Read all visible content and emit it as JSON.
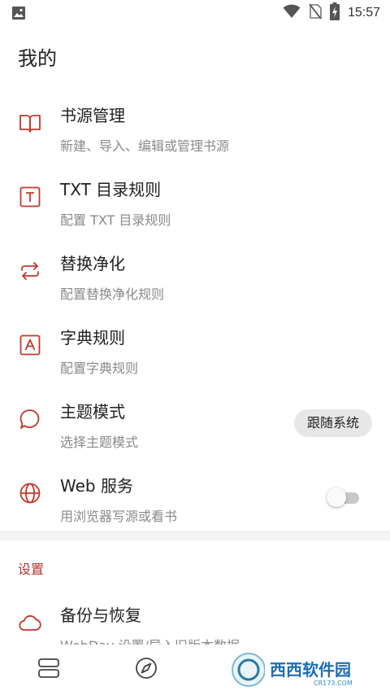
{
  "status_bar": {
    "time": "15:57"
  },
  "page": {
    "title": "我的"
  },
  "items": [
    {
      "title": "书源管理",
      "subtitle": "新建、导入、编辑或管理书源"
    },
    {
      "title": "TXT 目录规则",
      "subtitle": "配置 TXT 目录规则"
    },
    {
      "title": "替换净化",
      "subtitle": "配置替换净化规则"
    },
    {
      "title": "字典规则",
      "subtitle": "配置字典规则"
    },
    {
      "title": "主题模式",
      "subtitle": "选择主题模式",
      "value": "跟随系统"
    },
    {
      "title": "Web 服务",
      "subtitle": "用浏览器写源或看书",
      "toggle_on": false
    }
  ],
  "settings": {
    "section_title": "设置",
    "items": [
      {
        "title": "备份与恢复",
        "subtitle": "WebDav 设置/导入旧版本数据"
      }
    ]
  },
  "watermark": {
    "text": "西西软件园",
    "subtext": "CR173.COM"
  },
  "colors": {
    "accent": "#b5332a",
    "icon": "#c0392b"
  }
}
